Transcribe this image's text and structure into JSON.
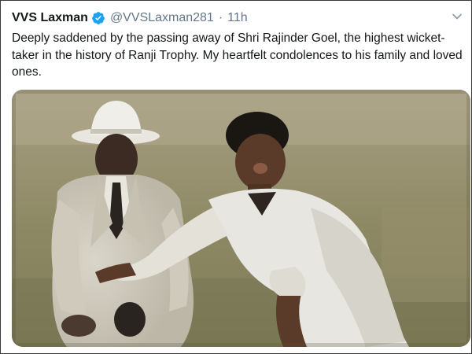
{
  "tweet": {
    "author_name": "VVS Laxman",
    "author_handle": "@VVSLaxman281",
    "separator": "·",
    "time": "11h",
    "text": "Deeply saddened by the passing away of Shri Rajinder Goel, the highest wicket-taker in the history of Ranji Trophy. My heartfelt condolences to his family and loved ones.",
    "verified_icon": "verified-badge-icon",
    "menu_icon": "chevron-down-icon"
  },
  "media": {
    "description_icon": "photo-umpire-and-bowler"
  },
  "colors": {
    "text": "#14171a",
    "secondary": "#657786",
    "verified": "#1da1f2",
    "frame": "#3a3a3a"
  }
}
